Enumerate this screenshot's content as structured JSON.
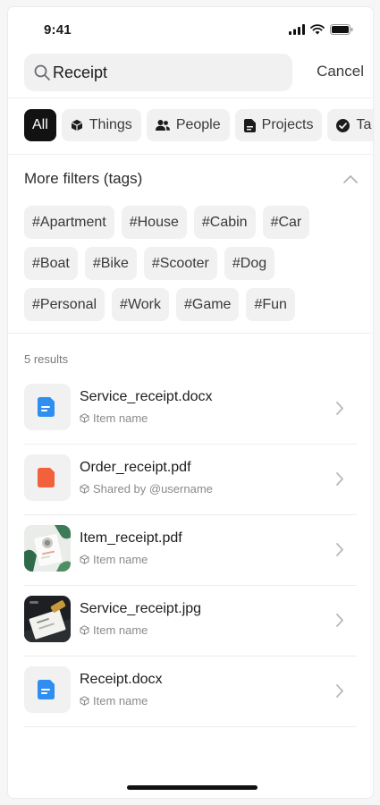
{
  "status_bar": {
    "time": "9:41"
  },
  "search": {
    "value": "Receipt",
    "cancel_label": "Cancel"
  },
  "categories": [
    {
      "label": "All",
      "icon": "all",
      "active": true
    },
    {
      "label": "Things",
      "icon": "cube-icon",
      "active": false
    },
    {
      "label": "People",
      "icon": "people-icon",
      "active": false
    },
    {
      "label": "Projects",
      "icon": "document-icon",
      "active": false
    },
    {
      "label": "Ta",
      "icon": "check-circle-icon",
      "active": false
    }
  ],
  "filters": {
    "title": "More filters (tags)",
    "tags": [
      [
        "#Apartment",
        "#House",
        "#Cabin",
        "#Car"
      ],
      [
        "#Boat",
        "#Bike",
        "#Scooter",
        "#Dog"
      ],
      [
        "#Personal",
        "#Work",
        "#Game",
        "#Fun"
      ]
    ]
  },
  "results": {
    "count_label": "5 results",
    "items": [
      {
        "name": "Service_receipt.docx",
        "meta": "Item name",
        "thumb": "docx-blue"
      },
      {
        "name": "Order_receipt.pdf",
        "meta": "Shared by @username",
        "thumb": "pdf-orange"
      },
      {
        "name": "Item_receipt.pdf",
        "meta": "Item name",
        "thumb": "photo-desk"
      },
      {
        "name": "Service_receipt.jpg",
        "meta": "Item name",
        "thumb": "photo-receipt"
      },
      {
        "name": "Receipt.docx",
        "meta": "Item name",
        "thumb": "docx-blue"
      }
    ]
  },
  "colors": {
    "active_chip": "#121212",
    "docx_blue": "#2f8ef0",
    "pdf_orange": "#f1613c"
  }
}
